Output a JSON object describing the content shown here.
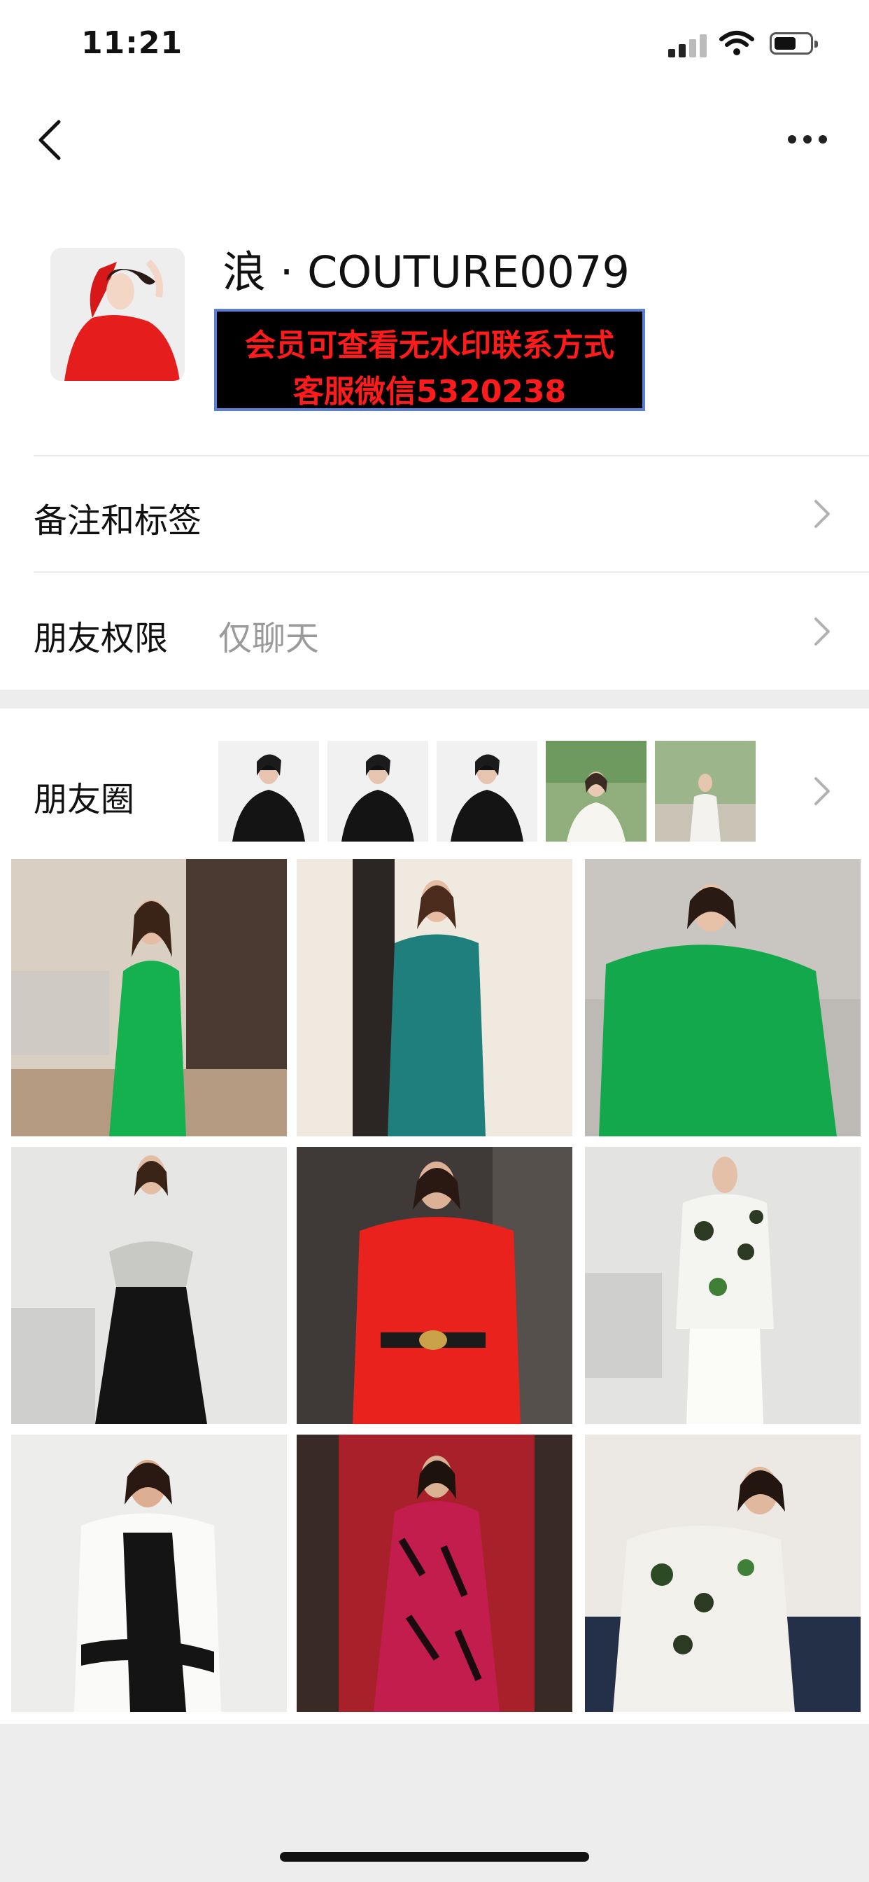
{
  "status_bar": {
    "time": "11:21"
  },
  "profile": {
    "name": "浪 · COUTURE0079",
    "watermark_line1": "会员可查看无水印联系方式",
    "watermark_line2": "客服微信5320238"
  },
  "rows": [
    {
      "label": "备注和标签",
      "value": ""
    },
    {
      "label": "朋友权限",
      "value": "仅聊天"
    }
  ],
  "moments": {
    "label": "朋友圈",
    "thumbnails": [
      "black-outfit",
      "black-outfit",
      "black-outfit",
      "white-blouse-garden",
      "white-outfit-garden"
    ]
  },
  "gallery": [
    "green-wrap-dress",
    "teal-suit",
    "green-blouse-trousers",
    "sequin-top-black-skirt",
    "red-blazer-dress",
    "floral-blazer-white-trousers",
    "white-black-colorblock-dress",
    "pink-print-maxi-dress",
    "floral-suit-seated"
  ],
  "colors": {
    "watermark_red": "#ff1b1b",
    "watermark_border": "#5a7fd8",
    "background": "#ededed"
  }
}
